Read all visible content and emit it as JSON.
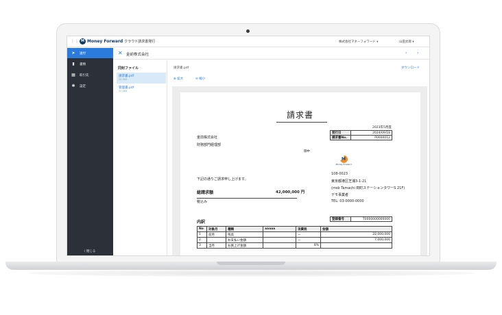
{
  "app": {
    "logo_mark": "M",
    "logo_name": "Money Forward",
    "product": "クラウド請求書発行",
    "company": "株式会社マネーフォワード ▾",
    "user": "山田太郎 ▾"
  },
  "sidebar": {
    "items": [
      {
        "label": "送付",
        "icon": "send-icon",
        "glyph": "➤"
      },
      {
        "label": "書類",
        "icon": "document-icon",
        "glyph": "▮"
      },
      {
        "label": "取引先",
        "icon": "building-icon",
        "glyph": "▦"
      },
      {
        "label": "設定",
        "icon": "gear-icon",
        "glyph": "✱"
      }
    ],
    "close_label": "〈 閉じる"
  },
  "header": {
    "close_glyph": "✕",
    "title": "金前株式会社",
    "prev": "‹",
    "next": "›"
  },
  "files": {
    "title": "同封ファイル",
    "items": [
      {
        "name": "請求書.pdf",
        "size": "20.0KB"
      },
      {
        "name": "管理書.pdf",
        "size": "20.0KB"
      }
    ]
  },
  "preview": {
    "filename": "請求書.pdf",
    "download": "ダウンロード",
    "zoom_in": "⊕ 拡大",
    "zoom_out": "⊖ 縮小"
  },
  "invoice": {
    "title": "請求書",
    "month": "2023年5月度",
    "client": "金前株式会社",
    "department": "財務部門経理部",
    "honorific": "御中",
    "meta": [
      {
        "key": "発行日",
        "value": "2024/09/18"
      },
      {
        "key": "請求書No.",
        "value": "P0000012"
      }
    ],
    "brand_mark": "M",
    "brand_text": "Money Forward",
    "postal": "108-0023",
    "address1": "東京都港区芝浦3-1-21",
    "address2": "(msb Tamachi 田町ステーションタワーS 21F)",
    "sender": "デモ事業者",
    "tel": "TEL: 03-0000-0000",
    "intro": "下記の通りご請求申し上げます。",
    "total_label": "総請求額",
    "total_value": "42,000,000 円",
    "tax_note": "税込み",
    "reg_key": "登録番号",
    "reg_value": "T0000000000000",
    "breakdown_title": "内訳",
    "columns": [
      "No",
      "対象月",
      "種類",
      "aaaaa",
      "消費税",
      "金額"
    ],
    "rows": [
      [
        "1",
        "前月",
        "残高",
        "",
        "ー",
        "22,000,000"
      ],
      [
        "2",
        "",
        "お支払い金額",
        "",
        "ー",
        "7,000,000"
      ],
      [
        "3",
        "当月",
        "お買上げ金額",
        "",
        "8%",
        ""
      ]
    ]
  }
}
